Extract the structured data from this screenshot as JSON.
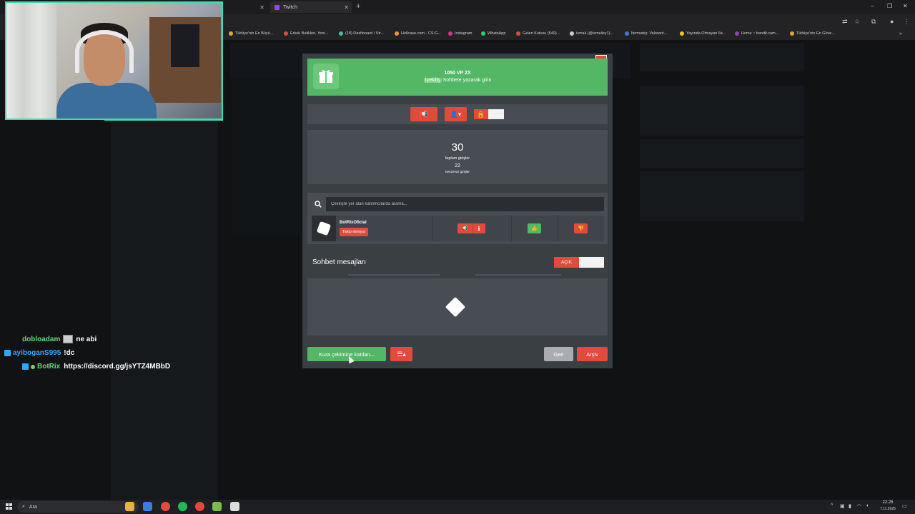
{
  "browser": {
    "tabs": [
      {
        "label": ""
      },
      {
        "label": "Twitch"
      }
    ],
    "new_tab": "+",
    "window_controls": [
      "–",
      "❐",
      "✕"
    ],
    "bookmarks": [
      {
        "label": "Türkiye'nin En Büyü...",
        "color": "#e0a82e"
      },
      {
        "label": "Erkek Butikleri, Yeni...",
        "color": "#e24b3b"
      },
      {
        "label": "(18) Dashboard / Str...",
        "color": "#53b7a0"
      },
      {
        "label": "Hellcase.com - CS:G...",
        "color": "#f39c12"
      },
      {
        "label": "Instagram",
        "color": "#d63384"
      },
      {
        "label": "WhatsApp",
        "color": "#25d366"
      },
      {
        "label": "Gelen Kutusu (549)...",
        "color": "#e24b3b"
      },
      {
        "label": "ismail (@ismailsy1)...",
        "color": "#cccccc"
      },
      {
        "label": "İtemsatış: Valorant...",
        "color": "#3a7bd5"
      },
      {
        "label": "Yayında Olmayan İla...",
        "color": "#f1c40f"
      },
      {
        "label": "Home :: bandit.cam...",
        "color": "#8e44ad"
      },
      {
        "label": "Türkiye'nin En Güve...",
        "color": "#e0a82e"
      }
    ]
  },
  "chat_overlay": [
    {
      "user": "dobloadam",
      "message": "ne abi",
      "has_emote": true
    },
    {
      "user": "ayiboganS995",
      "message": "!dc",
      "has_emote": false
    },
    {
      "user": "BotRix",
      "message": "https://discord.gg/jsYTZ4MBbD",
      "has_emote": false
    }
  ],
  "modal": {
    "close_label": "×",
    "banner": {
      "title": "1050 VP 2X",
      "keyword": "İçekiliş",
      "instruction": "Sohbete yazarak girin"
    },
    "stats": {
      "total_entries": "30",
      "total_entries_label": "toplam girişler",
      "non_sub_entries": "22",
      "non_sub_label": "benzersiz girişler"
    },
    "search_placeholder": "Çekilişte yer alan katılımcılarda arama...",
    "entrant": {
      "name": "BotRixOficial",
      "status": "Takip etmiyor"
    },
    "chat_section": {
      "title": "Sohbet mesajları",
      "toggle_label": "AÇIK"
    },
    "footer": {
      "enter_label": "Kura çekimine katılan...",
      "back_label": "Geri",
      "archive_label": "Arşiv"
    }
  },
  "taskbar": {
    "search_label": "Ara",
    "time": "22:25",
    "date": "7.11.2025"
  },
  "colors": {
    "green": "#54b765",
    "red": "#e24b3b",
    "modal_bg": "#3a3f44",
    "panel_bg": "#484d54",
    "webcam_border": "#3fdcb4"
  }
}
